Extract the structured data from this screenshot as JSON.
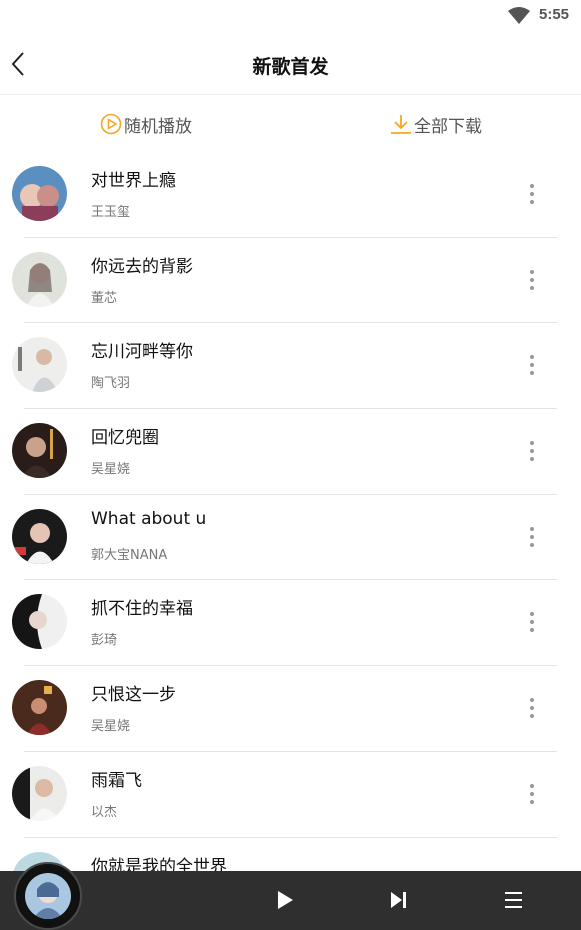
{
  "status_bar": {
    "time": "5:55",
    "wifi_icon": "wifi-icon"
  },
  "header": {
    "title": "新歌首发",
    "back_icon": "back-arrow-icon"
  },
  "actions": {
    "play_all_label": "随机播放",
    "download_all_label": "全部下载",
    "accent_color": "#f5a623"
  },
  "songs": [
    {
      "title": "对世界上瘾",
      "artist": "王玉玺"
    },
    {
      "title": "你远去的背影",
      "artist": "董芯"
    },
    {
      "title": "忘川河畔等你",
      "artist": "陶飞羽"
    },
    {
      "title": "回忆兜圈",
      "artist": "吴星娆"
    },
    {
      "title": "What about u",
      "artist": "郭大宝NANA"
    },
    {
      "title": "抓不住的幸福",
      "artist": "彭琦"
    },
    {
      "title": "只恨这一步",
      "artist": "吴星娆"
    },
    {
      "title": "雨霜飞",
      "artist": "以杰"
    },
    {
      "title": "你就是我的全世界",
      "artist": ""
    }
  ],
  "player": {
    "play_icon": "play-icon",
    "next_icon": "next-track-icon",
    "queue_icon": "playlist-icon"
  }
}
